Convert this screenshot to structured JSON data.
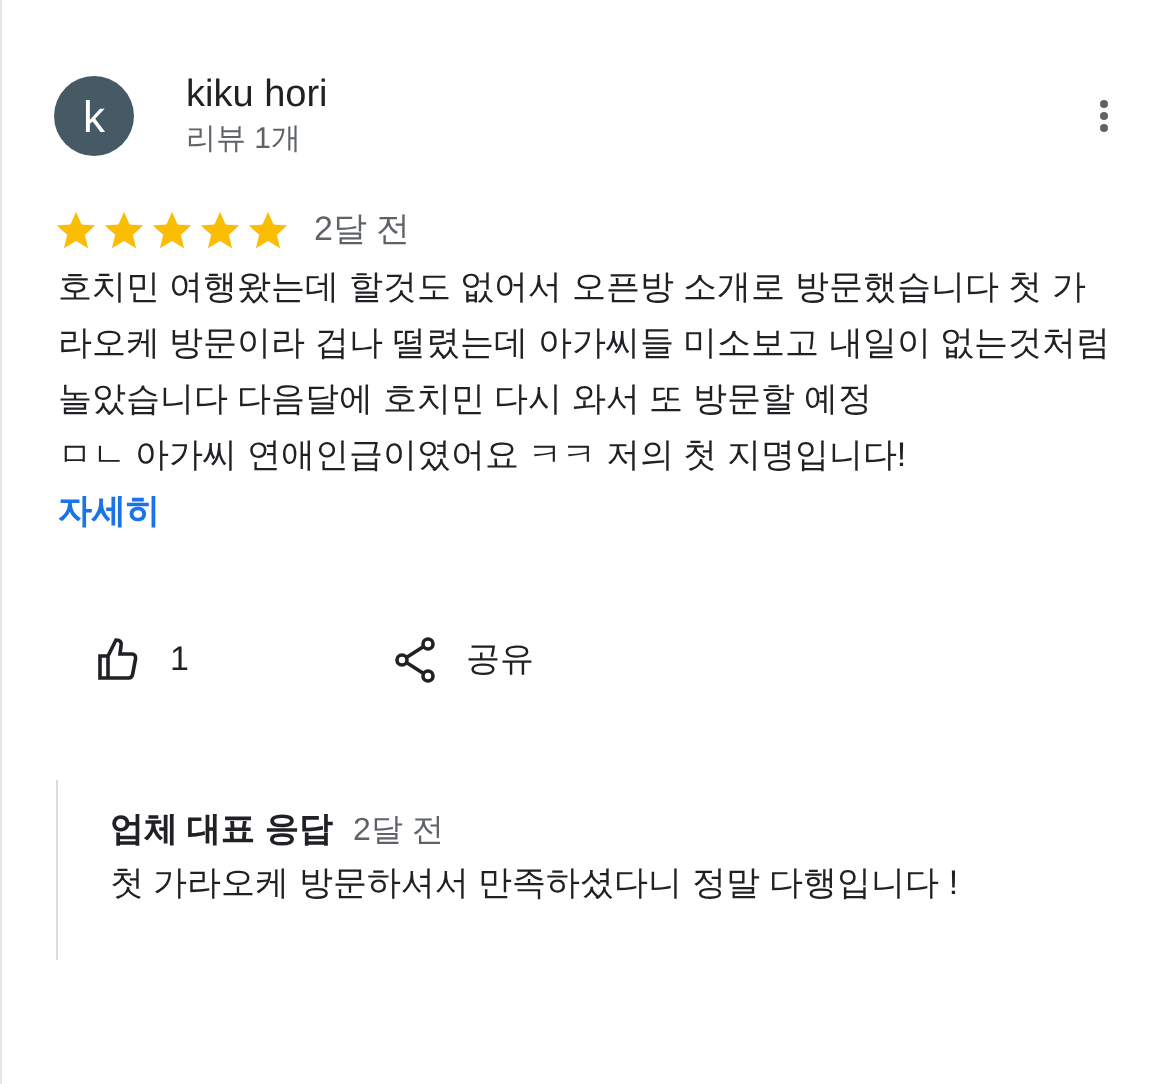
{
  "review": {
    "avatar_letter": "k",
    "author": "kiku hori",
    "review_count": "리뷰 1개",
    "stars": 5,
    "time": "2달 전",
    "paragraphs": [
      "호치민 여행왔는데 할것도 없어서 오픈방 소개로 방문했습니다 첫 가라오케 방문이라 겁나 떨렸는데 아가씨들 미소보고 내일이 없는것처럼 놀았습니다 다음달에 호치민 다시 와서 또 방문할 예정",
      "ㅁㄴ 아가씨 연애인급이였어요 ㅋㅋ 저의 첫 지명입니다!"
    ],
    "more_link": "자세히",
    "like_count": "1",
    "share_label": "공유"
  },
  "owner_reply": {
    "title": "업체 대표 응답",
    "time": "2달 전",
    "text": "첫 가라오케 방문하셔서 만족하셨다니 정말 다행입니다 !"
  }
}
